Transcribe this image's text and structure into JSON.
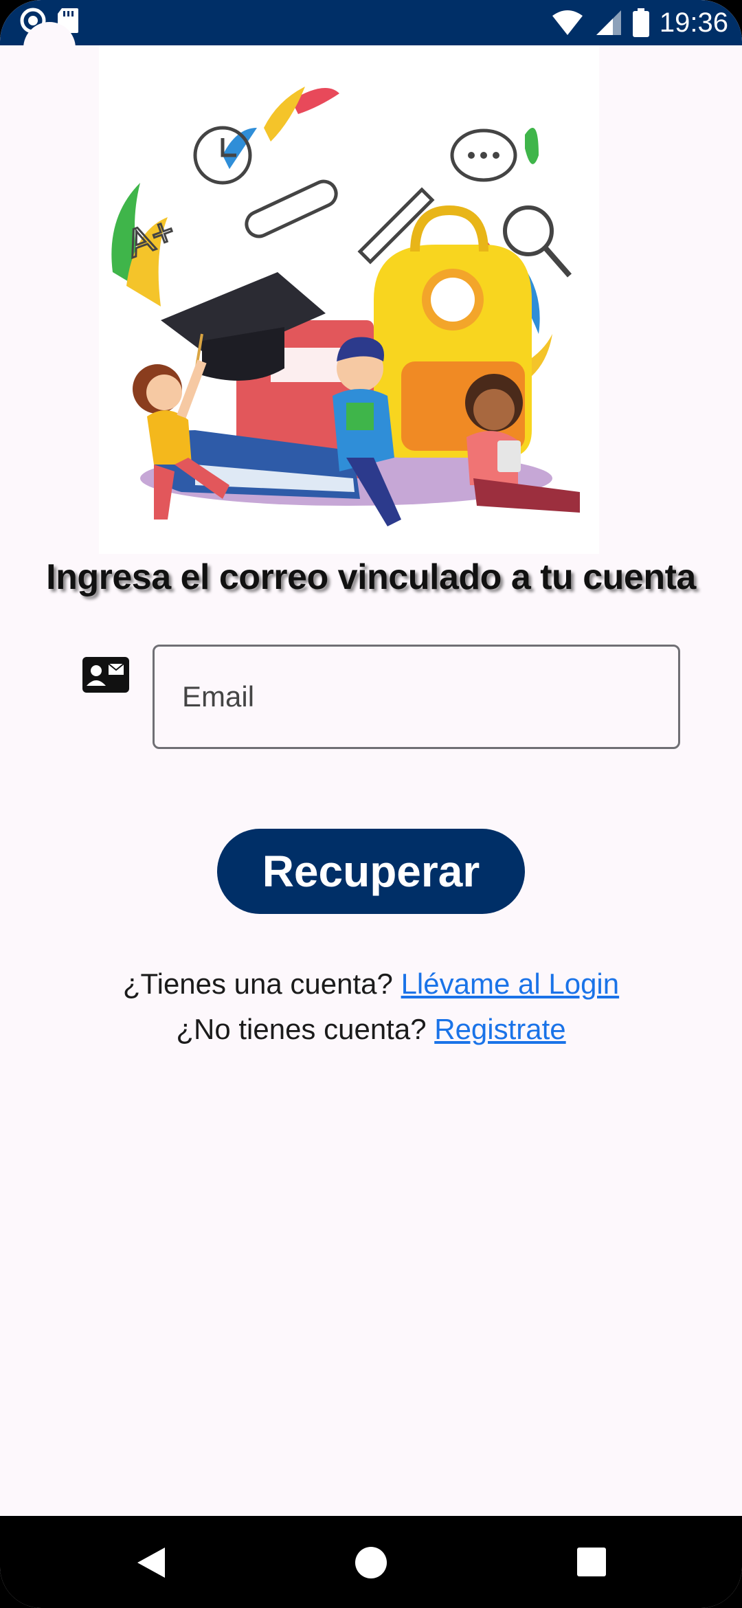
{
  "status_bar": {
    "time": "19:36",
    "icons": [
      "notification-icon",
      "sd-card-icon",
      "wifi-icon",
      "signal-icon",
      "battery-icon"
    ]
  },
  "illustration": {
    "label": "A+",
    "description_icon": "education-illustration-icon"
  },
  "form": {
    "heading": "Ingresa el correo vinculado a tu cuenta",
    "email_placeholder": "Email",
    "email_value": "",
    "submit_label": "Recuperar"
  },
  "links": {
    "login_prompt": "¿Tienes una cuenta?",
    "login_link": "Llévame al Login",
    "register_prompt": "¿No tienes cuenta?",
    "register_link": "Registrate"
  },
  "colors": {
    "primary": "#002f67",
    "link": "#1a73e8",
    "background": "#fdf8fc"
  },
  "nav_bar": {
    "icons": [
      "back-icon",
      "home-icon",
      "recents-icon"
    ]
  }
}
